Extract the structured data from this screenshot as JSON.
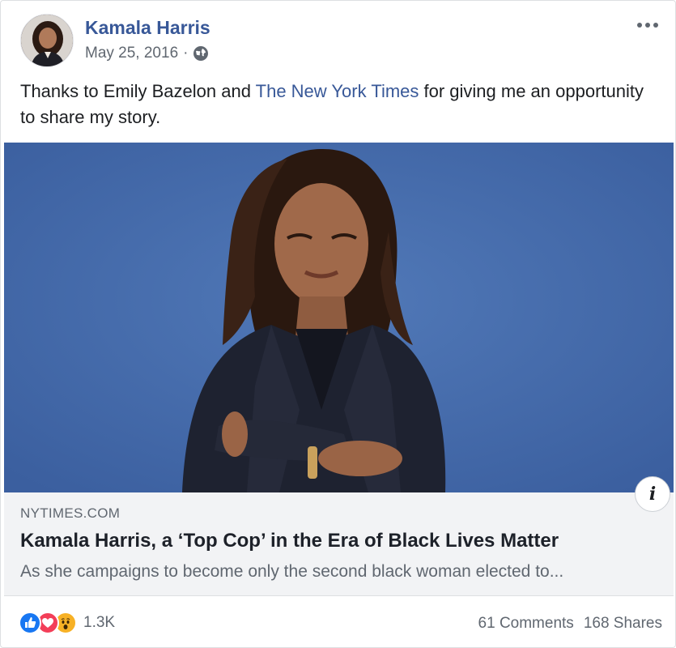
{
  "post": {
    "author": "Kamala Harris",
    "date": "May 25, 2016",
    "date_separator": "·",
    "message_before": "Thanks to Emily Bazelon and ",
    "message_link": "The New York Times",
    "message_after": " for giving me an opportunity to share my story.",
    "privacy_icon": "globe-icon",
    "more_icon": "more-options-icon"
  },
  "link_card": {
    "domain": "NYTIMES.COM",
    "title": "Kamala Harris, a ‘Top Cop’ in the Era of Black Lives Matter",
    "description": "As she campaigns to become only the second black woman elected to...",
    "info_label": "i"
  },
  "footer": {
    "reaction_icons": [
      "like-icon",
      "love-icon",
      "wow-icon"
    ],
    "reaction_count": "1.3K",
    "comments": "61 Comments",
    "shares": "168 Shares"
  },
  "colors": {
    "link": "#385898",
    "photo_background": "#4468a9",
    "like": "#1877f2",
    "love": "#f33e58",
    "wow": "#f7b125"
  }
}
